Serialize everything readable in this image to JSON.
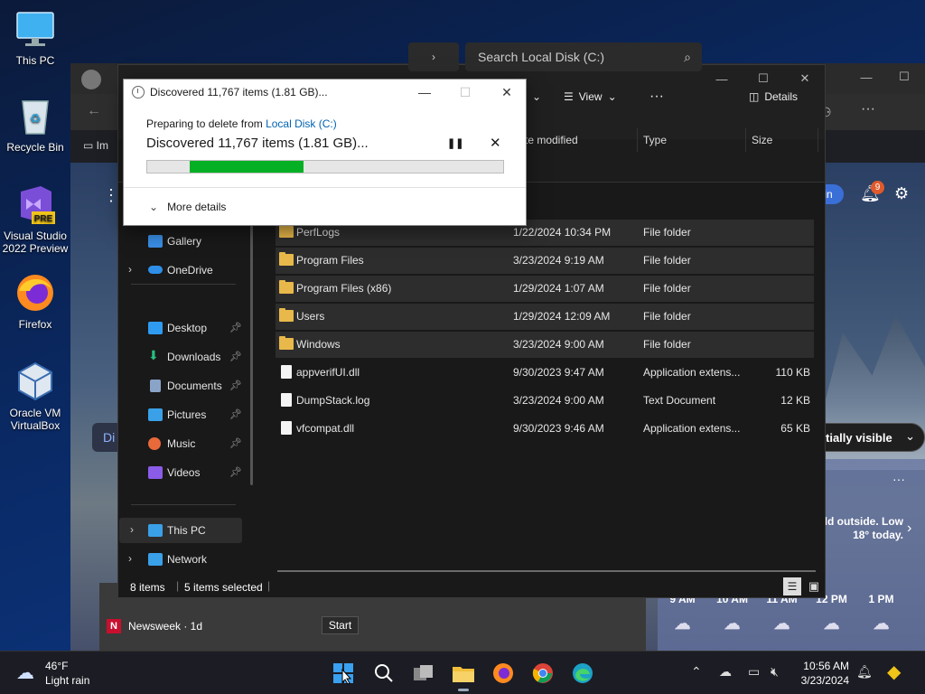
{
  "desktop": {
    "icons": [
      {
        "label": "This PC"
      },
      {
        "label": "Recycle Bin"
      },
      {
        "label": "Visual Studio 2022 Preview",
        "badge": "PRE"
      },
      {
        "label": "Firefox"
      },
      {
        "label": "Oracle VM VirtualBox"
      }
    ]
  },
  "browser_bg": {
    "tab_fragment": "Im",
    "news_badge": "9",
    "sign_in_fragment": "in",
    "tab_fragment_2": "Di",
    "visibility_label": "tially visible",
    "weather_text": "ld outside. Low 18° today.",
    "hours": [
      "9 AM",
      "10 AM",
      "11 AM",
      "12 PM",
      "1 PM"
    ],
    "news_source": "Newsweek · 1d"
  },
  "explorer": {
    "search_placeholder": "Search Local Disk (C:)",
    "toolbar": {
      "view_label": "View",
      "more_label": "···",
      "details_label": "Details"
    },
    "columns": {
      "date": "te modified",
      "type": "Type",
      "size": "Size"
    },
    "nav": [
      {
        "label": "Gallery",
        "color": "#3a8ee6"
      },
      {
        "label": "OneDrive",
        "color": "#2f8fe8",
        "expandable": true
      },
      {
        "label": "Desktop",
        "color": "#2f9bf0",
        "pinned": true
      },
      {
        "label": "Downloads",
        "color": "#2bbd7e",
        "pinned": true
      },
      {
        "label": "Documents",
        "color": "#8aa4c8",
        "pinned": true
      },
      {
        "label": "Pictures",
        "color": "#3aa0e8",
        "pinned": true
      },
      {
        "label": "Music",
        "color": "#e86a3a",
        "pinned": true
      },
      {
        "label": "Videos",
        "color": "#8b5ce8",
        "pinned": true
      },
      {
        "label": "This PC",
        "color": "#3aa0e8",
        "expandable": true
      },
      {
        "label": "Network",
        "color": "#3aa0e8",
        "expandable": true
      }
    ],
    "files": [
      {
        "name": "PerfLogs",
        "date": "1/22/2024 10:34 PM",
        "type": "File folder",
        "size": "",
        "kind": "folder",
        "selected": true
      },
      {
        "name": "Program Files",
        "date": "3/23/2024 9:19 AM",
        "type": "File folder",
        "size": "",
        "kind": "folder",
        "selected": true
      },
      {
        "name": "Program Files (x86)",
        "date": "1/29/2024 1:07 AM",
        "type": "File folder",
        "size": "",
        "kind": "folder",
        "selected": true
      },
      {
        "name": "Users",
        "date": "1/29/2024 12:09 AM",
        "type": "File folder",
        "size": "",
        "kind": "folder",
        "selected": true
      },
      {
        "name": "Windows",
        "date": "3/23/2024 9:00 AM",
        "type": "File folder",
        "size": "",
        "kind": "folder",
        "selected": true
      },
      {
        "name": "appverifUI.dll",
        "date": "9/30/2023 9:47 AM",
        "type": "Application extens...",
        "size": "110 KB",
        "kind": "file",
        "selected": false
      },
      {
        "name": "DumpStack.log",
        "date": "3/23/2024 9:00 AM",
        "type": "Text Document",
        "size": "12 KB",
        "kind": "file",
        "selected": false
      },
      {
        "name": "vfcompat.dll",
        "date": "9/30/2023 9:46 AM",
        "type": "Application extens...",
        "size": "65 KB",
        "kind": "file",
        "selected": false
      }
    ],
    "status": {
      "count": "8 items",
      "selected": "5 items selected"
    }
  },
  "dialog": {
    "title": "Discovered 11,767 items (1.81 GB)...",
    "preparing_prefix": "Preparing to delete from ",
    "preparing_link": "Local Disk (C:)",
    "main_text": "Discovered 11,767 items (1.81 GB)...",
    "more_details": "More details",
    "progress": {
      "start_fraction": 0.12,
      "end_fraction": 0.44
    },
    "accent": "#06b025"
  },
  "tooltip": {
    "text": "Start"
  },
  "taskbar": {
    "weather_temp": "46°F",
    "weather_cond": "Light rain",
    "time": "10:56 AM",
    "date": "3/23/2024",
    "apps": [
      "start-icon",
      "search-icon",
      "task-view-icon",
      "file-explorer-icon",
      "firefox-icon",
      "chrome-icon",
      "edge-icon"
    ]
  }
}
